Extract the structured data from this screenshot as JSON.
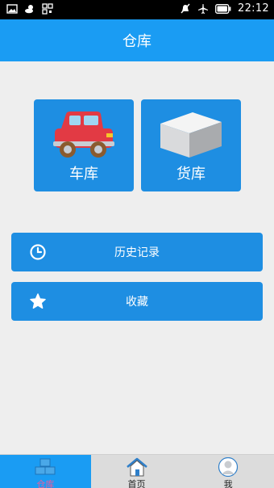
{
  "status_bar": {
    "time": "22:12",
    "left_icons": [
      "image-icon",
      "weather-icon",
      "qr-icon"
    ],
    "right_icons": [
      "mute-icon",
      "airplane-icon",
      "battery-icon"
    ]
  },
  "app_bar": {
    "title": "仓库"
  },
  "tiles": {
    "garage": {
      "label": "车库",
      "icon": "car-icon"
    },
    "warehouse": {
      "label": "货库",
      "icon": "box-icon"
    }
  },
  "rows": {
    "history": {
      "label": "历史记录",
      "icon": "clock-icon"
    },
    "favorites": {
      "label": "收藏",
      "icon": "star-icon"
    }
  },
  "tabbar": {
    "tabs": [
      {
        "label": "仓库",
        "icon": "warehouse-icon",
        "active": true
      },
      {
        "label": "首页",
        "icon": "home-icon",
        "active": false
      },
      {
        "label": "我",
        "icon": "profile-icon",
        "active": false
      }
    ]
  },
  "colors": {
    "primary": "#1a9cf3",
    "tile": "#1e8ee2",
    "background": "#eeeeee",
    "active_tab_label": "#f05a9a"
  }
}
